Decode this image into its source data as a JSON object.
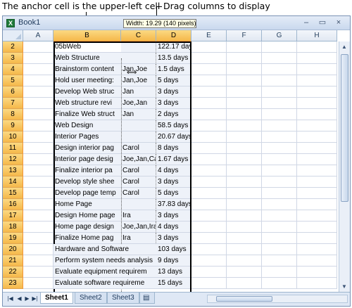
{
  "callouts": {
    "anchor": "The anchor cell is the upper-left cell",
    "drag": "Drag columns to display"
  },
  "window": {
    "title": "Book1",
    "minimize": "–",
    "restore": "▭",
    "close": "×"
  },
  "tooltip": "Width: 19.29 (140 pixels)",
  "columns": [
    "A",
    "B",
    "C",
    "D",
    "E",
    "F",
    "G",
    "H"
  ],
  "rows": [
    {
      "num": "2",
      "b": "05bWeb",
      "c": "",
      "d": "122.17 days"
    },
    {
      "num": "3",
      "b": "Web Structure",
      "c": "",
      "d": "13.5 days"
    },
    {
      "num": "4",
      "b": "Brainstorm content",
      "c": "Jan,Joe",
      "d": "1.5 days"
    },
    {
      "num": "5",
      "b": "Hold user meeting:",
      "c": "Jan,Joe",
      "d": "5 days"
    },
    {
      "num": "6",
      "b": "Develop Web struc",
      "c": "Jan",
      "d": "3 days"
    },
    {
      "num": "7",
      "b": "Web structure revi",
      "c": "Joe,Jan",
      "d": "3 days"
    },
    {
      "num": "8",
      "b": "Finalize Web struct",
      "c": "Jan",
      "d": "2 days"
    },
    {
      "num": "9",
      "b": "Web Design",
      "c": "",
      "d": "58.5 days"
    },
    {
      "num": "10",
      "b": "Interior Pages",
      "c": "",
      "d": "20.67 days"
    },
    {
      "num": "11",
      "b": "Design interior pag",
      "c": "Carol",
      "d": "8 days"
    },
    {
      "num": "12",
      "b": "Interior page desig",
      "c": "Joe,Jan,Ca",
      "d": "1.67 days"
    },
    {
      "num": "13",
      "b": "Finalize interior pa",
      "c": "Carol",
      "d": "4 days"
    },
    {
      "num": "14",
      "b": "Develop style shee",
      "c": "Carol",
      "d": "3 days"
    },
    {
      "num": "15",
      "b": "Develop page temp",
      "c": "Carol",
      "d": "5 days"
    },
    {
      "num": "16",
      "b": "Home Page",
      "c": "",
      "d": "37.83 days"
    },
    {
      "num": "17",
      "b": "Design Home page",
      "c": "Ira",
      "d": "3 days"
    },
    {
      "num": "18",
      "b": "Home page design",
      "c": "Joe,Jan,Ira",
      "d": "4 days"
    },
    {
      "num": "19",
      "b": "Finalize Home pag",
      "c": "Ira",
      "d": "3 days"
    },
    {
      "num": "20",
      "b": "Hardware and Software",
      "c": "",
      "d": "103 days"
    },
    {
      "num": "21",
      "b": "Perform system needs analysis",
      "c": "",
      "d": "9 days"
    },
    {
      "num": "22",
      "b": "Evaluate equipment requirem",
      "c": "",
      "d": "13 days"
    },
    {
      "num": "23",
      "b": "Evaluate software requireme",
      "c": "",
      "d": "15 days"
    }
  ],
  "tabs": [
    "Sheet1",
    "Sheet2",
    "Sheet3"
  ]
}
